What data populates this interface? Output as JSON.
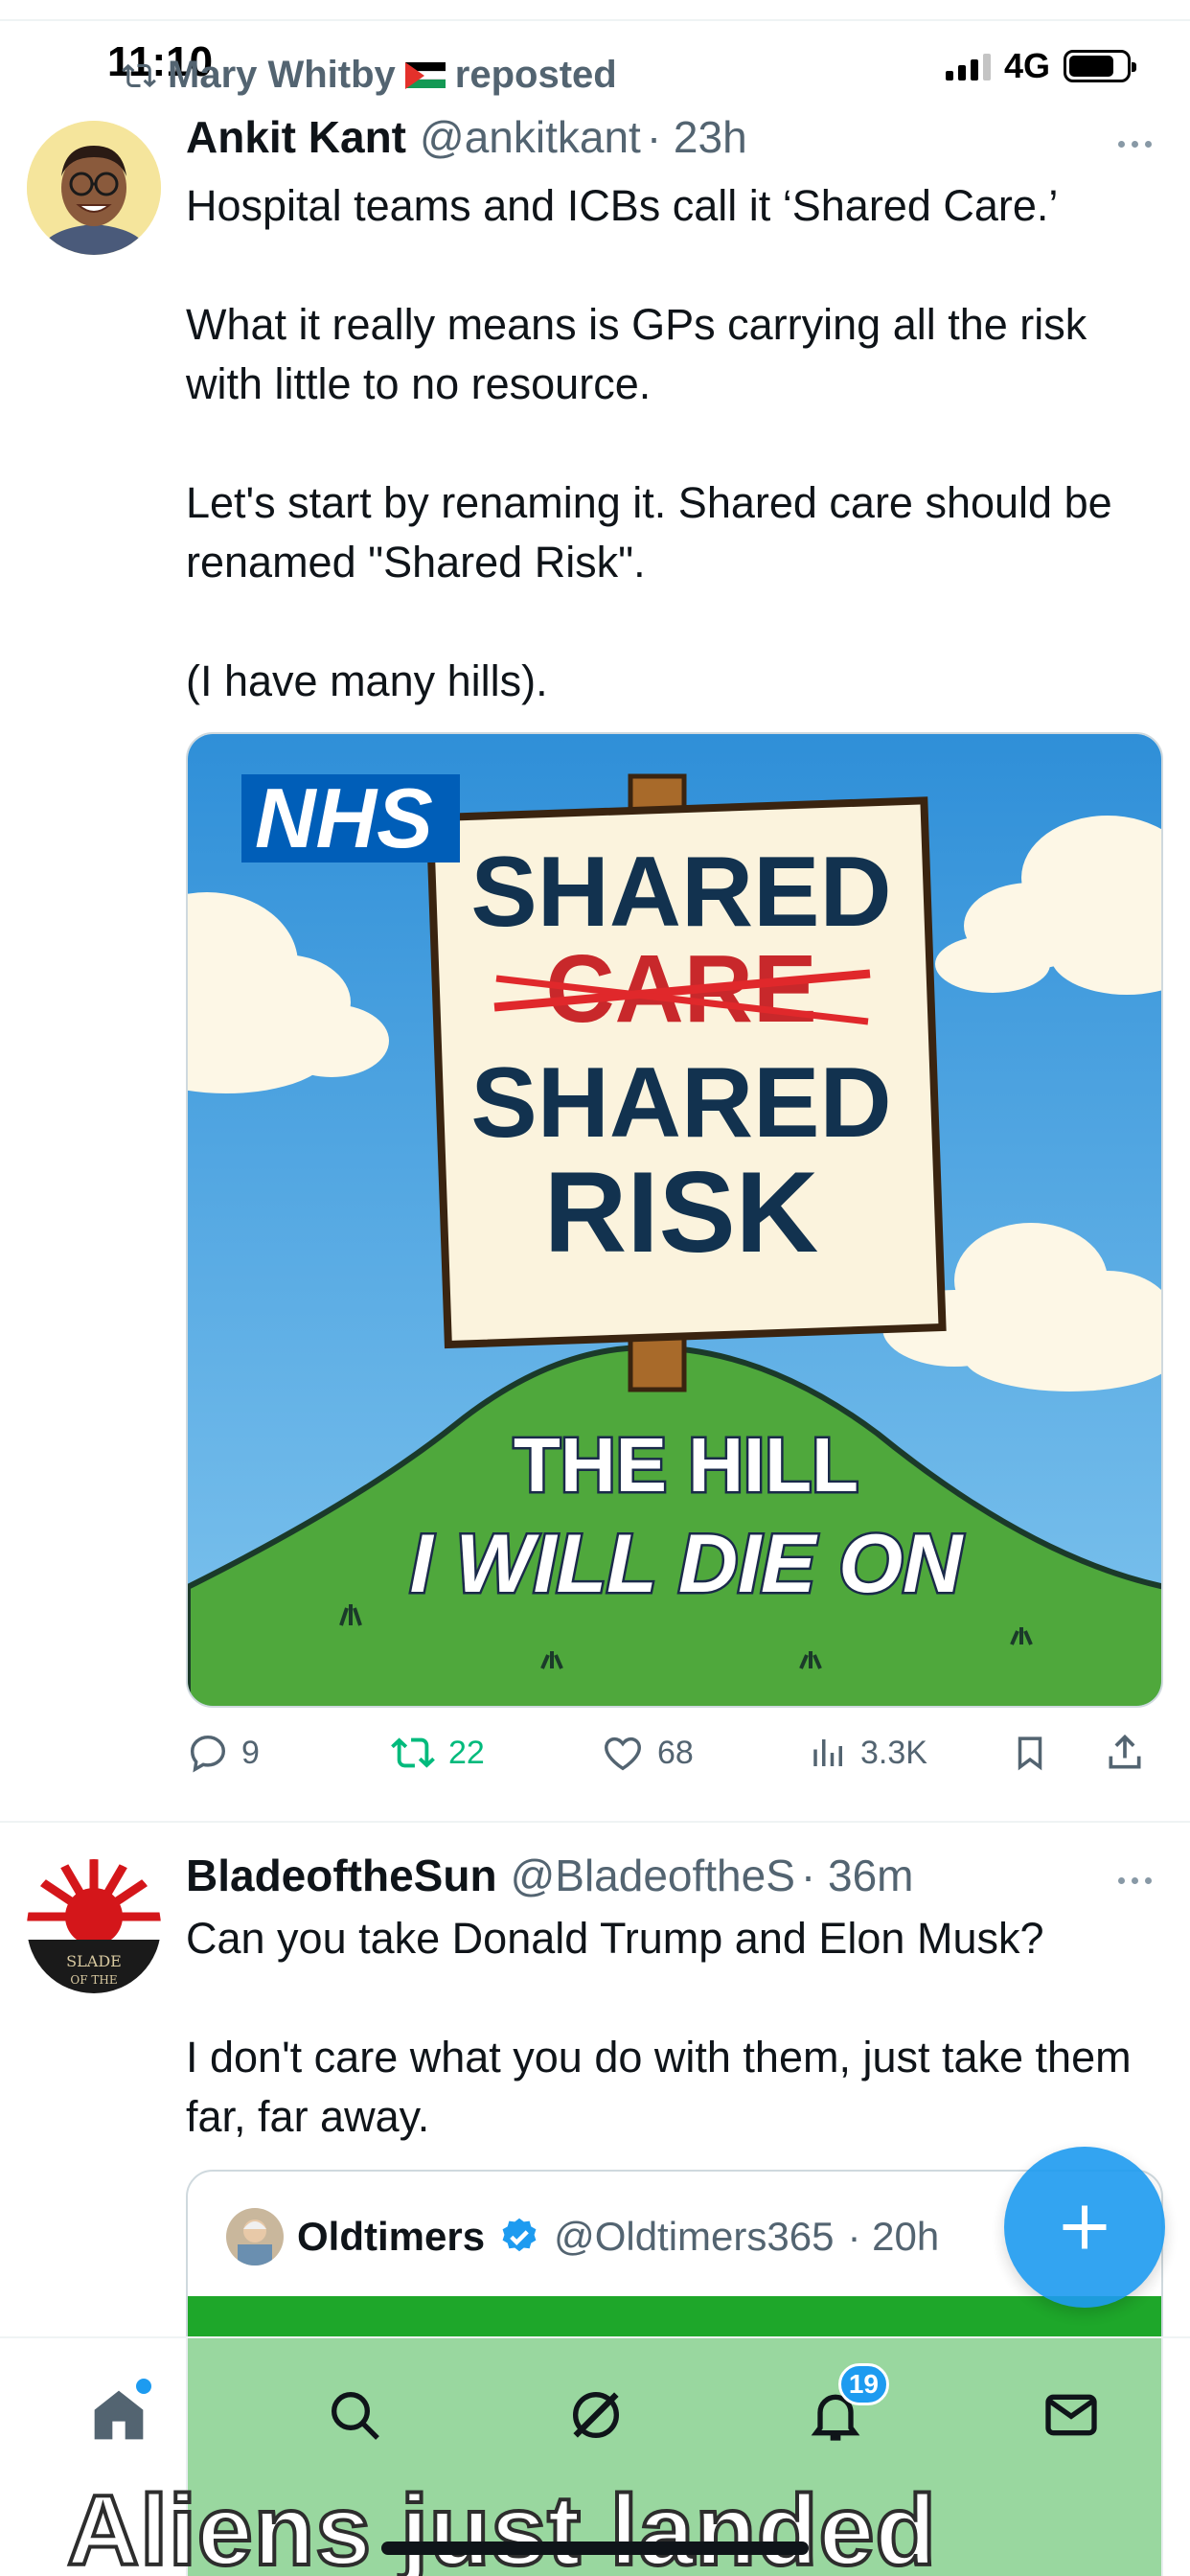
{
  "status": {
    "time": "11:10",
    "network": "4G"
  },
  "repost": {
    "label": "Mary Whitby",
    "suffix": "reposted"
  },
  "tweet1": {
    "name": "Ankit Kant",
    "handle": "@ankitkant",
    "time": "· 23h",
    "paragraphs": [
      "Hospital teams and ICBs call it ‘Shared Care.’",
      "What it really means is GPs carrying all the risk with little to no resource.",
      "Let's start by renaming it. Shared care should be renamed \"Shared Risk\".",
      "(I have many hills)."
    ],
    "image": {
      "badge": "NHS",
      "sign_line1": "SHARED",
      "sign_struck": "CARE",
      "sign_line3": "SHARED",
      "sign_line4": "RISK",
      "hill_line1": "THE HILL",
      "hill_line2": "I WILL DIE ON"
    },
    "actions": {
      "replies": "9",
      "reposts": "22",
      "likes": "68",
      "views": "3.3K"
    }
  },
  "tweet2": {
    "name": "BladeoftheSun",
    "handle": "@BladeoftheS",
    "time": "· 36m",
    "paragraphs": [
      "Can you take Donald Trump and Elon Musk?",
      "I don't care what you do with them, just take them far, far away."
    ],
    "quote": {
      "name": "Oldtimers",
      "handle": "@Oldtimers365",
      "time": "· 20h",
      "caption": "Aliens just landed"
    }
  },
  "tabbar": {
    "notifications_badge": "19"
  },
  "colors": {
    "accent": "#1d9bf0",
    "repost_green": "#00ba7c",
    "muted": "#536471"
  }
}
